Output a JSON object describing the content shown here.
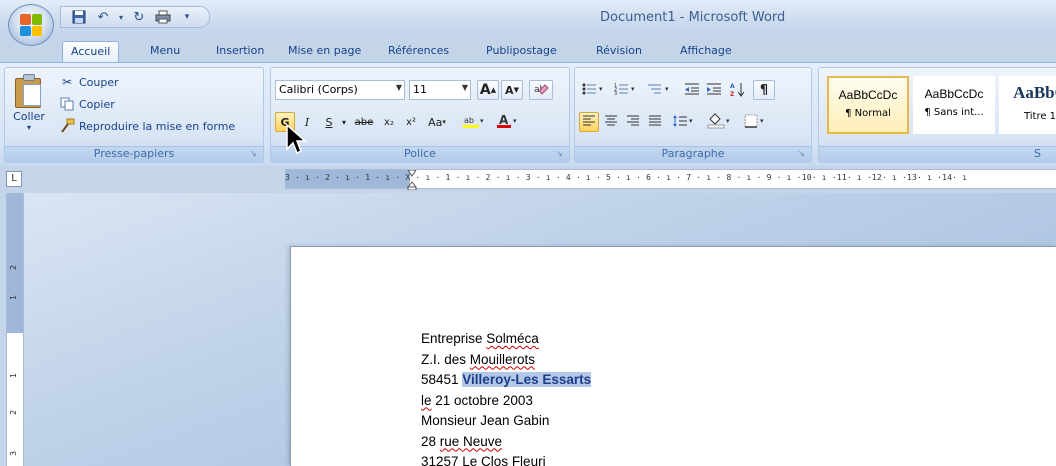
{
  "window": {
    "title": "Document1 - Microsoft Word"
  },
  "qat": {
    "icons": [
      "save-icon",
      "undo-icon",
      "redo-icon",
      "print-icon",
      "customize-icon"
    ]
  },
  "tabs": [
    {
      "label": "Accueil",
      "active": true
    },
    {
      "label": "Menu"
    },
    {
      "label": "Insertion"
    },
    {
      "label": "Mise en page"
    },
    {
      "label": "Références"
    },
    {
      "label": "Publipostage"
    },
    {
      "label": "Révision"
    },
    {
      "label": "Affichage"
    }
  ],
  "clipboard": {
    "paste": "Coller",
    "cut": "Couper",
    "copy": "Copier",
    "format_painter": "Reproduire la mise en forme",
    "group": "Presse-papiers"
  },
  "font": {
    "family": "Calibri (Corps)",
    "size": "11",
    "group": "Police",
    "bold": "G",
    "italic": "I",
    "underline": "S",
    "strike": "abe",
    "subscript": "x₂",
    "superscript": "x²",
    "case": "Aa",
    "grow": "A",
    "shrink": "A"
  },
  "paragraph": {
    "group": "Paragraphe"
  },
  "styles": {
    "items": [
      {
        "sample": "AaBbCcDc",
        "name": "¶ Normal",
        "selected": true
      },
      {
        "sample": "AaBbCcDc",
        "name": "¶ Sans int..."
      },
      {
        "sample": "AaBbC",
        "name": "Titre 1"
      }
    ],
    "group_partial": "S"
  },
  "ruler": {
    "horizontal": "3 · ı · 2 · ı · 1 · ı · X · ı · 1 · ı · 2 · ı · 3 · ı · 4 · ı · 5 · ı · 6 · ı · 7 · ı · 8 · ı · 9 · ı ·10· ı ·11· ı ·12· ı ·13· ı ·14· ı",
    "corner": "L",
    "vertical": [
      "2",
      "1",
      "1",
      "2",
      "3"
    ]
  },
  "document": {
    "line1_a": "Entreprise ",
    "line1_b": "Solméca",
    "line2_a": "Z.I. des ",
    "line2_b": "Mouillerots",
    "line3_a": "58451 ",
    "line3_b": "Villeroy-Les Essarts",
    "line4_a": "le",
    "line4_b": " 21 octobre 2003",
    "line5": "Monsieur Jean Gabin",
    "line6_a": "28 ",
    "line6_b": "rue Neuve",
    "line7": "31257 Le Clos Fleuri"
  },
  "colors": {
    "ribbon": "#dae6f5",
    "selection": "#b3c8e8",
    "accent": "#15428b"
  }
}
